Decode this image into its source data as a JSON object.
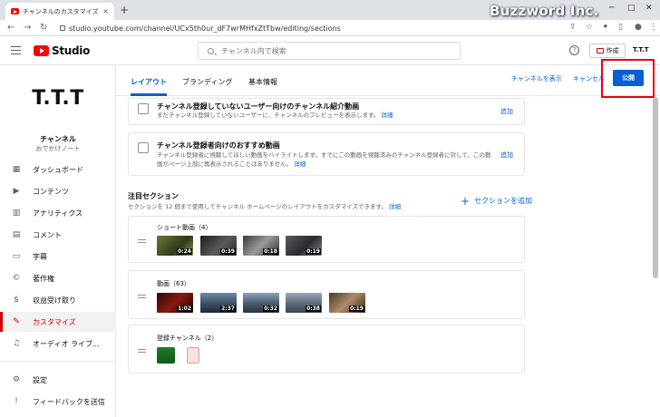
{
  "browser": {
    "tab_title": "チャンネルのカスタマイズ - YouTube S",
    "tab_close": "×",
    "new_tab": "+",
    "url": "studio.youtube.com/channel/UCx5th0ur_dF7wrMHfxZtTbw/editing/sections",
    "watermark": "Buzzword Inc."
  },
  "header": {
    "logo_text": "Studio",
    "search_placeholder": "チャンネル内で検索",
    "help": "?",
    "create_label": "作成",
    "account": "T.T.T"
  },
  "sidebar": {
    "channel_logo": "T.T.T",
    "channel_label": "チャンネル",
    "channel_name": "おでかけノート",
    "items": [
      {
        "label": "ダッシュボード"
      },
      {
        "label": "コンテンツ"
      },
      {
        "label": "アナリティクス"
      },
      {
        "label": "コメント"
      },
      {
        "label": "字幕"
      },
      {
        "label": "著作権"
      },
      {
        "label": "収益受け取り"
      },
      {
        "label": "カスタマイズ"
      },
      {
        "label": "オーディオ ライブ..."
      },
      {
        "label": "設定"
      },
      {
        "label": "フィードバックを送信"
      }
    ]
  },
  "tabs": {
    "layout": "レイアウト",
    "branding": "ブランディング",
    "basic": "基本情報",
    "view_channel": "チャンネルを表示",
    "cancel": "キャンセル",
    "publish": "公開"
  },
  "cards": {
    "intro": {
      "title": "チャンネル登録していないユーザー向けのチャンネル紹介動画",
      "desc": "まだチャンネル登録していないユーザーに、チャンネルのプレビューを表示します。",
      "link": "詳細",
      "add": "追加"
    },
    "featured": {
      "title": "チャンネル登録者向けのおすすめ動画",
      "desc": "チャンネル登録者に視聴してほしい動画をハイライトします。すでにこの動画を視聴済みのチャンネル登録者に対して、この動画がページ上部に再表示されることはありません。",
      "link": "詳細",
      "add": "追加"
    }
  },
  "sections": {
    "title": "注目セクション",
    "desc": "セクションを 12 個まで使用してチャンネル ホームページのレイアウトをカスタマイズできます。",
    "link": "詳細",
    "add": "セクションを追加",
    "shorts": {
      "title": "ショート動画（4）",
      "durations": [
        "0:24",
        "0:39",
        "0:18",
        "0:19"
      ]
    },
    "videos": {
      "title": "動画（63）",
      "durations": [
        "1:02",
        "2:37",
        "0:32",
        "0:38",
        "0:19"
      ]
    },
    "subs": {
      "title": "登録チャンネル（2）"
    }
  }
}
